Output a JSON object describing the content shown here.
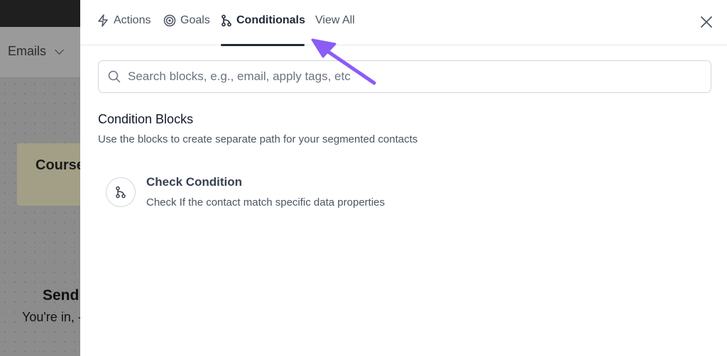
{
  "background": {
    "header_title": "Emails",
    "card_title": "Course",
    "send_title": "Send",
    "send_subtitle": "You're in, -"
  },
  "tabs": [
    {
      "label": "Actions",
      "icon": "lightning-icon",
      "active": false
    },
    {
      "label": "Goals",
      "icon": "target-icon",
      "active": false
    },
    {
      "label": "Conditionals",
      "icon": "branch-icon",
      "active": true
    },
    {
      "label": "View All",
      "icon": "",
      "active": false
    }
  ],
  "search": {
    "placeholder": "Search blocks, e.g., email, apply tags, etc",
    "value": ""
  },
  "section": {
    "title": "Condition Blocks",
    "description": "Use the blocks to create separate path for your segmented contacts"
  },
  "blocks": [
    {
      "title": "Check Condition",
      "description": "Check If the contact match specific data properties",
      "icon": "branch-icon"
    }
  ],
  "colors": {
    "annotation_arrow": "#8b5cf6",
    "active_tab": "#1f2937"
  }
}
